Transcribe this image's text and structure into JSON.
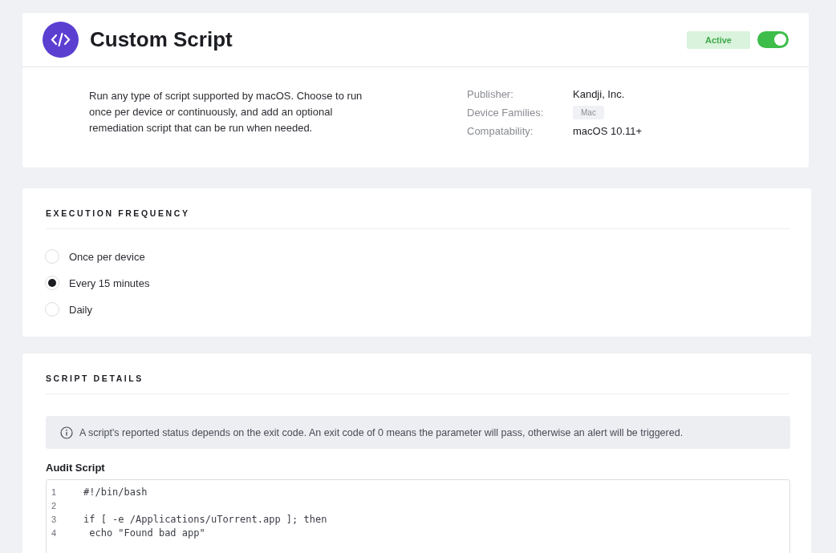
{
  "header": {
    "title": "Custom Script",
    "status": "Active",
    "enabled": true,
    "description": "Run any type of script supported by macOS. Choose to run once per device or continuously, and add an optional remediation script that can be run when needed.",
    "details": [
      {
        "label": "Publisher:",
        "value": "Kandji, Inc.",
        "kind": "text"
      },
      {
        "label": "Device Families:",
        "value": "Mac",
        "kind": "tag"
      },
      {
        "label": "Compatability:",
        "value": "macOS 10.11+",
        "kind": "text"
      }
    ]
  },
  "execution_frequency": {
    "title": "EXECUTION FREQUENCY",
    "options": [
      {
        "label": "Once per device",
        "selected": false
      },
      {
        "label": "Every 15 minutes",
        "selected": true
      },
      {
        "label": "Daily",
        "selected": false
      }
    ]
  },
  "script_details": {
    "title": "SCRIPT DETAILS",
    "info": "A script's reported status depends on the exit code. An exit code of 0 means the parameter will pass, otherwise an alert will be triggered.",
    "audit_label": "Audit Script",
    "lines": [
      {
        "number": "1",
        "code": "#!/bin/bash"
      },
      {
        "number": "2"
      },
      {
        "number": "3",
        "code": "if [ -e /Applications/uTorrent.app ]; then"
      },
      {
        "number": "4",
        "code": " echo \"Found bad app\""
      }
    ]
  }
}
